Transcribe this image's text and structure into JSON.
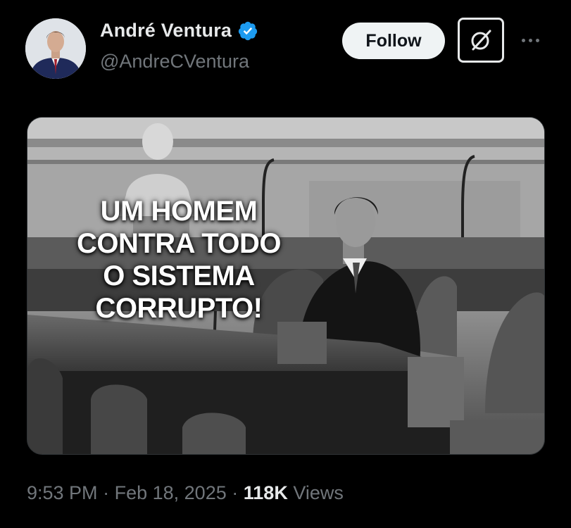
{
  "tweet": {
    "author": {
      "display_name": "André Ventura",
      "handle": "@AndreCVentura",
      "verified": true,
      "avatar_icon": "profile-photo"
    },
    "actions": {
      "follow_label": "Follow",
      "grok_icon": "grok-icon",
      "more_icon": "more-options-icon"
    },
    "media": {
      "overlay_text": "UM HOMEM CONTRA TODO O SISTEMA CORRUPTO!",
      "overlay_lines": [
        "UM HOMEM",
        "CONTRA TODO",
        "O SISTEMA",
        "CORRUPTO!"
      ]
    },
    "meta": {
      "time": "9:53 PM",
      "separator": "·",
      "date": "Feb 18, 2025",
      "views_count": "118K",
      "views_label": "Views"
    }
  },
  "colors": {
    "background": "#000000",
    "primary_text": "#e7e9ea",
    "secondary_text": "#71767b",
    "verified_blue": "#1d9bf0",
    "follow_bg": "#eff3f4"
  }
}
